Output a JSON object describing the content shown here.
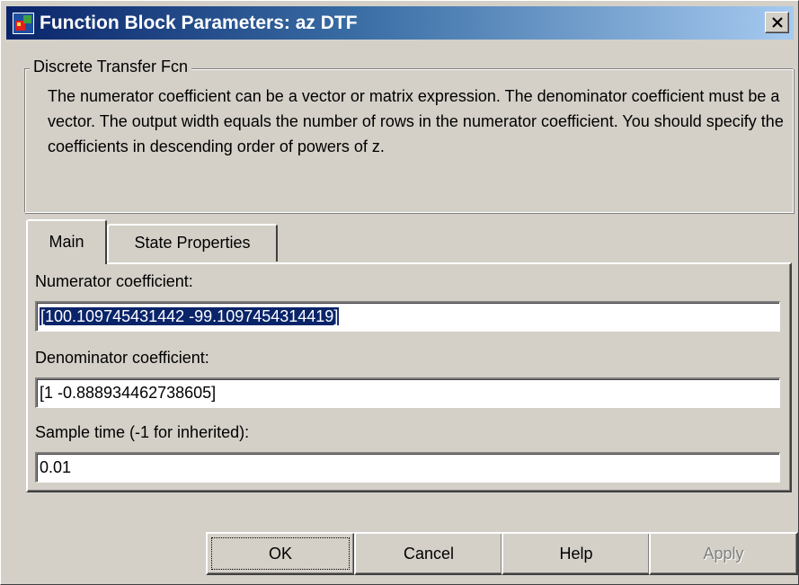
{
  "window": {
    "title": "Function Block Parameters: az DTF",
    "title_gradient": [
      "#0a246a",
      "#a6caf0"
    ],
    "icons": [
      "simulink-block-icon",
      "close-icon"
    ]
  },
  "group": {
    "title": "Discrete Transfer Fcn",
    "description": "The numerator coefficient can be a vector or matrix expression. The denominator coefficient must be a vector. The output width equals the number of rows in the numerator coefficient. You should specify the coefficients in descending order of powers of z."
  },
  "tabs": [
    {
      "label": "Main",
      "selected": true
    },
    {
      "label": "State Properties",
      "selected": false
    }
  ],
  "fields": {
    "numerator": {
      "label": "Numerator coefficient:",
      "value": "[100.109745431442 -99.1097454314419]",
      "selected": true
    },
    "denominator": {
      "label": "Denominator coefficient:",
      "value": "[1 -0.888934462738605]"
    },
    "sample_time": {
      "label": "Sample time (-1 for inherited):",
      "value": "0.01"
    }
  },
  "buttons": {
    "ok": "OK",
    "cancel": "Cancel",
    "help": "Help",
    "apply": "Apply",
    "apply_enabled": false
  }
}
